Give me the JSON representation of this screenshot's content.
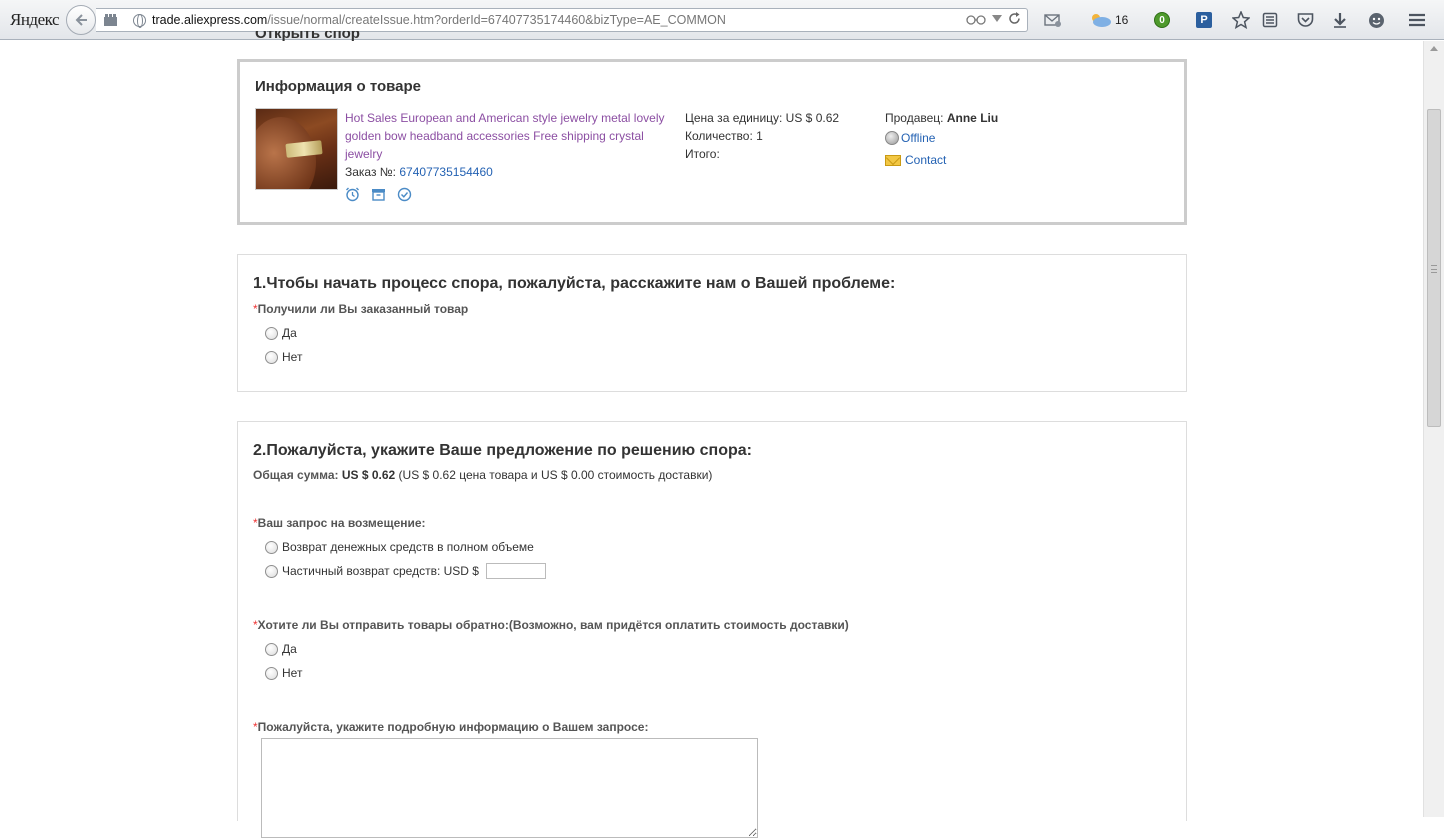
{
  "browser": {
    "brand": "Яндекс",
    "url_domain": "trade.aliexpress.com",
    "url_path": "/issue/normal/createIssue.htm?orderId=67407735174460&bizType=AE_COMMON",
    "weather_temp": "16",
    "green_badge_count": "0",
    "p_badge": "P"
  },
  "page": {
    "clipped_heading": "Открыть спор"
  },
  "product": {
    "section_title": "Информация о товаре",
    "name": "Hot Sales European and American style jewelry metal lovely golden bow headband accessories Free shipping crystal jewelry",
    "order_label": "Заказ №:",
    "order_number": "67407735154460",
    "unit_price": "Цена за единицу: US $ 0.62",
    "quantity": "Количество: 1",
    "total": "Итого:",
    "seller_label": "Продавец:",
    "seller_name": "Anne Liu",
    "status": "Offline",
    "contact": "Contact"
  },
  "section1": {
    "title": "1.Чтобы начать процесс спора, пожалуйста, расскажите нам о Вашей проблеме:",
    "question": "Получили ли Вы заказанный товар",
    "options": [
      "Да",
      "Нет"
    ]
  },
  "section2": {
    "title": "2.Пожалуйста, укажите Ваше предложение по решению спора:",
    "total_label": "Общая сумма:",
    "total_value": "US $ 0.62",
    "total_detail": " (US $ 0.62 цена товара и US $ 0.00 стоимость доставки)",
    "refund_question": "Ваш запрос на возмещение:",
    "refund_options": [
      "Возврат денежных средств в полном объеме",
      "Частичный возврат средств: USD $"
    ],
    "return_question": "Хотите ли Вы отправить товары обратно:(Возможно, вам придётся оплатить стоимость доставки)",
    "return_options": [
      "Да",
      "Нет"
    ],
    "details_question": "Пожалуйста, укажите подробную информацию о Вашем запросе:"
  },
  "required_mark": "*"
}
